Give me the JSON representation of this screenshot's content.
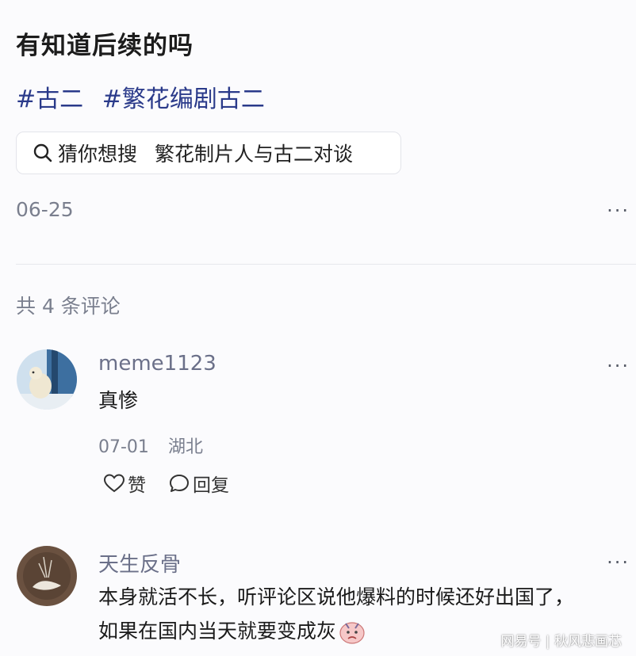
{
  "post": {
    "title": "有知道后续的吗",
    "tags": [
      "#古二",
      "#繁花编剧古二"
    ],
    "search": {
      "prefix": "猜你想搜",
      "query": "繁花制片人与古二对谈"
    },
    "date": "06-25",
    "more": "···"
  },
  "comments_header": "共 4 条评论",
  "comments": [
    {
      "username": "meme1123",
      "text": "真惨",
      "date": "07-01",
      "location": "湖北",
      "like_label": "赞",
      "reply_label": "回复",
      "more": "···"
    },
    {
      "username": "天生反骨",
      "text_line1": "本身就活不长，听评论区说他爆料的时候还好出国了，",
      "text_line2": "如果在国内当天就要变成灰",
      "more": "···"
    }
  ],
  "watermark": "网易号 | 秋风悲画芯",
  "colors": {
    "tag": "#2a3a8a",
    "muted": "#7a7f8e",
    "username": "#6b7089"
  }
}
